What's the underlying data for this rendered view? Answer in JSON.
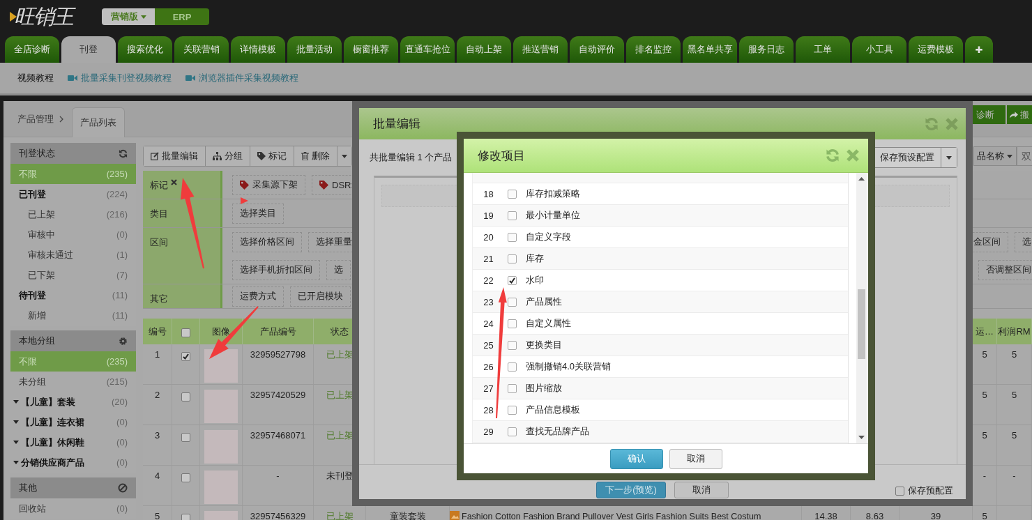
{
  "header": {
    "logo": "旺销王",
    "editions": [
      {
        "label": "营销版",
        "selected": true
      },
      {
        "label": "ERP",
        "selected": false
      }
    ]
  },
  "main_tabs": [
    {
      "label": "全店诊断",
      "selected": false
    },
    {
      "label": "刊登",
      "selected": true
    },
    {
      "label": "搜索优化",
      "selected": false
    },
    {
      "label": "关联营销",
      "selected": false
    },
    {
      "label": "详情模板",
      "selected": false
    },
    {
      "label": "批量活动",
      "selected": false
    },
    {
      "label": "橱窗推荐",
      "selected": false
    },
    {
      "label": "直通车抢位",
      "selected": false
    },
    {
      "label": "自动上架",
      "selected": false
    },
    {
      "label": "推送营销",
      "selected": false
    },
    {
      "label": "自动评价",
      "selected": false
    },
    {
      "label": "排名监控",
      "selected": false
    },
    {
      "label": "黑名单共享",
      "selected": false
    },
    {
      "label": "服务日志",
      "selected": false
    },
    {
      "label": "工单",
      "selected": false
    },
    {
      "label": "小工具",
      "selected": false
    },
    {
      "label": "运费模板",
      "selected": false
    },
    {
      "label": "✚",
      "selected": false
    }
  ],
  "subnav": {
    "label": "视频教程",
    "links": [
      "批量采集刊登视频教程",
      "浏览器插件采集视频教程"
    ]
  },
  "breadcrumb": {
    "parent": "产品管理",
    "current": "产品列表"
  },
  "top_actions": [
    "诊断",
    "搬"
  ],
  "sidebar": {
    "sections": [
      {
        "title": "刊登状态",
        "items": [
          {
            "label": "不限",
            "count": "(235)",
            "selected": true,
            "kind": "item"
          },
          {
            "label": "已刊登",
            "count": "(224)",
            "selected": false,
            "kind": "parent",
            "children": [
              {
                "label": "已上架",
                "count": "(216)",
                "selected": false,
                "kind": "item"
              },
              {
                "label": "审核中",
                "count": "(0)",
                "selected": false,
                "kind": "item"
              },
              {
                "label": "审核未通过",
                "count": "(1)",
                "selected": false,
                "kind": "item"
              },
              {
                "label": "已下架",
                "count": "(7)",
                "selected": false,
                "kind": "item"
              }
            ]
          },
          {
            "label": "待刊登",
            "count": "(11)",
            "selected": false,
            "kind": "parent",
            "children": [
              {
                "label": "新增",
                "count": "(11)",
                "selected": false,
                "kind": "item"
              }
            ]
          }
        ]
      },
      {
        "title": "本地分组",
        "items": [
          {
            "label": "不限",
            "count": "(235)",
            "selected": true,
            "kind": "item"
          },
          {
            "label": "未分组",
            "count": "(215)",
            "selected": false,
            "kind": "item"
          },
          {
            "label": "【儿童】套装",
            "count": "(20)",
            "selected": false,
            "kind": "group"
          },
          {
            "label": "【儿童】连衣裙",
            "count": "(0)",
            "selected": false,
            "kind": "group"
          },
          {
            "label": "【儿童】休闲鞋",
            "count": "(0)",
            "selected": false,
            "kind": "group"
          },
          {
            "label": "分销供应商产品",
            "count": "(0)",
            "selected": false,
            "kind": "group"
          }
        ]
      },
      {
        "title": "其他",
        "items": [
          {
            "label": "回收站",
            "count": "(0)",
            "selected": false,
            "kind": "item"
          }
        ]
      }
    ]
  },
  "toolbar": {
    "buttons": [
      "批量编辑",
      "分组",
      "标记",
      "删除"
    ],
    "sort": "品名称",
    "search_placeholder": "双"
  },
  "filters": [
    {
      "label": "标记",
      "clearable": true,
      "rows": [
        {
          "left": [
            {
              "text": "采集源下架",
              "kind": "tag"
            },
            {
              "text": "DSR:",
              "kind": "tag"
            }
          ]
        }
      ]
    },
    {
      "label": "类目",
      "clearable": false,
      "rows": [
        {
          "left": [
            {
              "text": "选择类目",
              "kind": "plain"
            }
          ]
        }
      ]
    },
    {
      "label": "区间",
      "clearable": false,
      "rows": [
        {
          "left": [
            {
              "text": "选择价格区间",
              "kind": "plain"
            },
            {
              "text": "选择重量",
              "kind": "plain"
            }
          ],
          "right": [
            {
              "text": "金区间"
            },
            {
              "text": "选"
            }
          ]
        },
        {
          "left": [
            {
              "text": "选择手机折扣区间",
              "kind": "plain"
            },
            {
              "text": "选",
              "kind": "plain"
            }
          ],
          "right": [
            {
              "text": "否调整区间"
            }
          ]
        }
      ]
    },
    {
      "label": "其它",
      "clearable": false,
      "rows": [
        {
          "left": [
            {
              "text": "运费方式",
              "kind": "plain"
            },
            {
              "text": "已开启模块",
              "kind": "plain"
            }
          ]
        }
      ]
    }
  ],
  "table": {
    "columns": [
      "编号",
      "图像",
      "产品编号",
      "状态"
    ],
    "select_all": {
      "checked": false
    },
    "right_columns": [
      "运…",
      "利润RM"
    ],
    "rows": [
      {
        "no": "1",
        "checked": true,
        "product_id": "32959527798",
        "status": "已上架",
        "listed": true,
        "column_11": "5",
        "column_12": "5"
      },
      {
        "no": "2",
        "checked": false,
        "product_id": "32957420529",
        "status": "已上架",
        "listed": true,
        "column_11": "5",
        "column_12": "5"
      },
      {
        "no": "3",
        "checked": false,
        "product_id": "32957468071",
        "status": "已上架",
        "listed": true,
        "column_11": "5",
        "column_12": "5"
      },
      {
        "no": "4",
        "checked": false,
        "product_id": "-",
        "status": "未刊登",
        "listed": false,
        "column_11": "-",
        "column_12": "-"
      },
      {
        "no": "5",
        "checked": false,
        "product_id": "32957456329",
        "status": "已上架",
        "listed": true,
        "column_6": "童装套装",
        "column_7": "Fashion Cotton Fashion Brand Pullover Vest Girls Fashion Suits Best Costum",
        "column_8": "14.38",
        "column_9": "8.63",
        "column_10": "39",
        "column_11": "5"
      }
    ]
  },
  "bulk_edit": {
    "title": "批量编辑",
    "summary": "共批量编辑 1 个产品",
    "preset_button": "保存预设配置",
    "next_button": "下一步(预览)",
    "cancel_button": "取消",
    "save_preset": {
      "label": "保存预配置",
      "checked": false
    }
  },
  "edit_items": {
    "title": "修改项目",
    "items": [
      {
        "no": "18",
        "label": "库存扣减策略",
        "checked": false
      },
      {
        "no": "19",
        "label": "最小计量单位",
        "checked": false
      },
      {
        "no": "20",
        "label": "自定义字段",
        "checked": false
      },
      {
        "no": "21",
        "label": "库存",
        "checked": false
      },
      {
        "no": "22",
        "label": "水印",
        "checked": true
      },
      {
        "no": "23",
        "label": "产品属性",
        "checked": false
      },
      {
        "no": "24",
        "label": "自定义属性",
        "checked": false
      },
      {
        "no": "25",
        "label": "更换类目",
        "checked": false
      },
      {
        "no": "26",
        "label": "强制撤销4.0关联营销",
        "checked": false
      },
      {
        "no": "27",
        "label": "图片缩放",
        "checked": false
      },
      {
        "no": "28",
        "label": "产品信息模板",
        "checked": false
      },
      {
        "no": "29",
        "label": "查找无品牌产品",
        "checked": false
      }
    ],
    "confirm_button": "确认",
    "cancel_button": "取消"
  }
}
